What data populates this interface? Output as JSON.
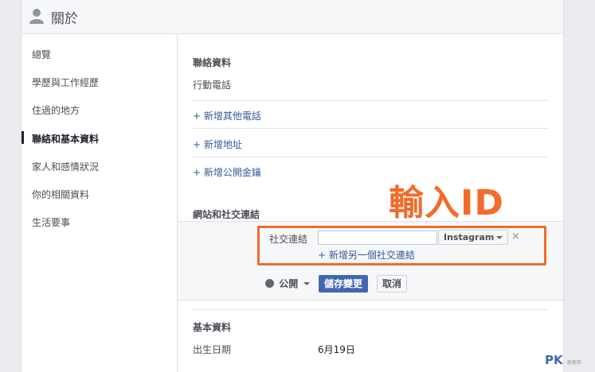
{
  "header": {
    "title": "關於"
  },
  "sidebar": {
    "items": [
      {
        "label": "總覽"
      },
      {
        "label": "學歷與工作經歷"
      },
      {
        "label": "住過的地方"
      },
      {
        "label": "聯絡和基本資料",
        "active": true
      },
      {
        "label": "家人和感情狀況"
      },
      {
        "label": "你的相關資料"
      },
      {
        "label": "生活要事"
      }
    ]
  },
  "contact": {
    "section_title": "聯絡資料",
    "phone_label": "行動電話",
    "add_phone": "+ 新增其他電話",
    "add_address": "+ 新增地址",
    "add_public_key": "+ 新增公開金鑰"
  },
  "websites": {
    "section_title": "網站和社交連結",
    "social_label": "社交連結",
    "social_input_value": "",
    "platform": "Instagram",
    "remove_glyph": "×",
    "add_social_link": "+ 新增另一個社交連結",
    "privacy_label": "公開",
    "save_label": "儲存變更",
    "cancel_label": "取消"
  },
  "annotation": {
    "text": "輸入ID",
    "color": "#f26b2a"
  },
  "basic": {
    "section_title": "基本資料",
    "birthday_label": "出生日期",
    "birthday_value": "6月19日"
  },
  "watermark": {
    "logo": "PK",
    "tagline": "痞客邦"
  },
  "colors": {
    "accent": "#4267b2",
    "link": "#365899",
    "highlight": "#f26b2a"
  }
}
